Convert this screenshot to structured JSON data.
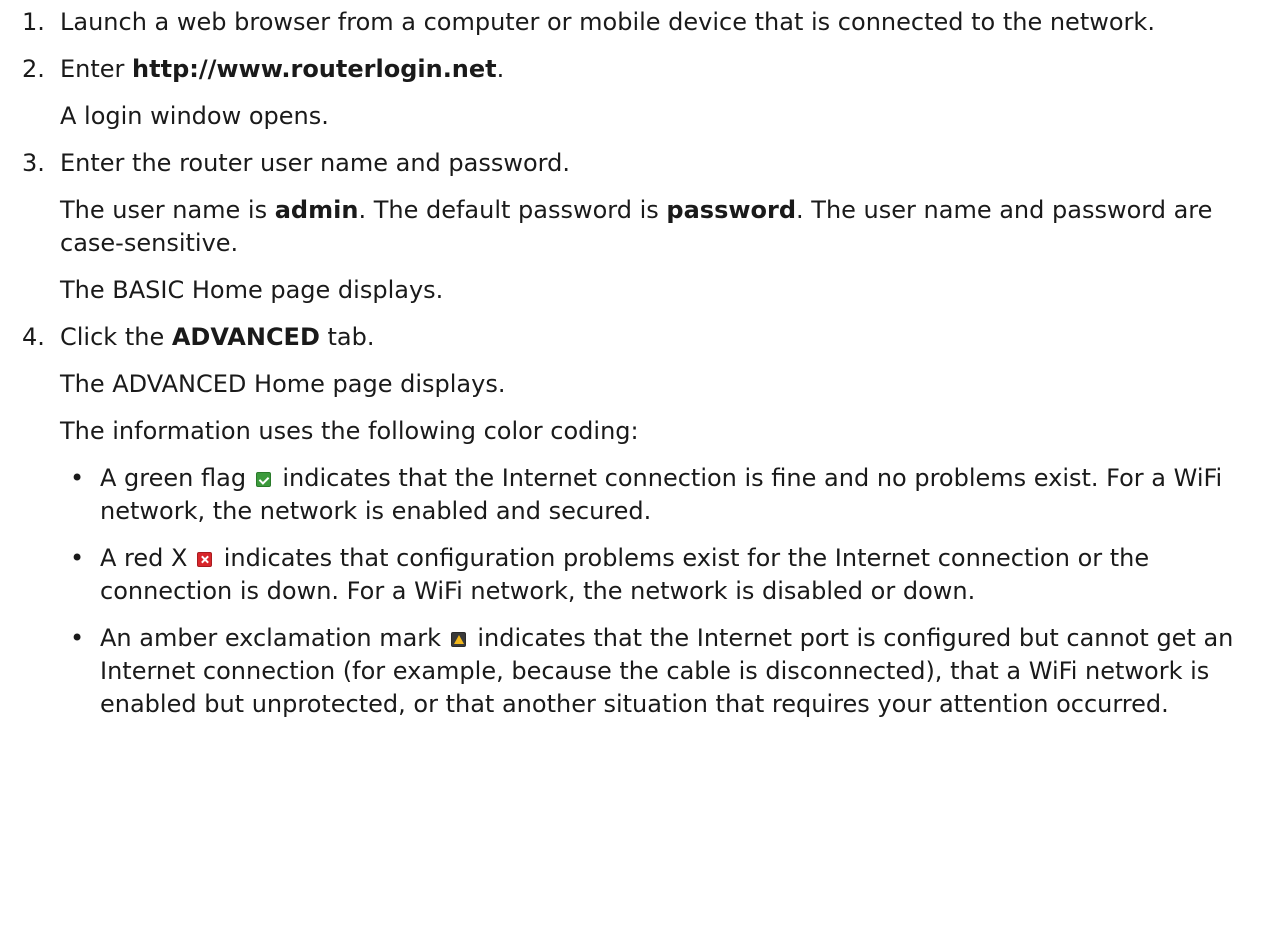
{
  "steps": [
    {
      "num": "1.",
      "lines": [
        "Launch a web browser from a computer or mobile device that is connected to the network."
      ]
    },
    {
      "num": "2.",
      "enter_prefix": "Enter ",
      "enter_url": "http://www.routerlogin.net",
      "enter_suffix": ".",
      "result": "A login window opens."
    },
    {
      "num": "3.",
      "title": "Enter the router user name and password.",
      "cred_a": "The user name is ",
      "cred_user": "admin",
      "cred_b": ". The default password is ",
      "cred_pass": "password",
      "cred_c": ". The user name and password are case-sensitive.",
      "result": "The BASIC Home page displays."
    },
    {
      "num": "4.",
      "click_a": "Click the ",
      "click_tab": "ADVANCED",
      "click_b": " tab.",
      "result": "The ADVANCED Home page displays.",
      "intro": "The information uses the following color coding:",
      "bullets": [
        {
          "before": "A green flag",
          "after": "indicates that the Internet connection is fine and no problems exist. For a WiFi network, the network is enabled and secured.",
          "icon": "green-check-flag",
          "color": "#3c9a3c"
        },
        {
          "before": "A red X",
          "after": "indicates that configuration problems exist for the Internet connection or the connection is down. For a WiFi network, the network is disabled or down.",
          "icon": "red-x-flag",
          "color": "#d8262b"
        },
        {
          "before": "An amber exclamation mark",
          "after": "indicates that the Internet port is configured but cannot get an Internet connection (for example, because the cable is disconnected), that a WiFi network is enabled but unprotected, or that another situation that requires your attention occurred.",
          "icon": "amber-exclamation-flag",
          "color": "#f2b81d"
        }
      ]
    }
  ],
  "bullet_char": "•"
}
